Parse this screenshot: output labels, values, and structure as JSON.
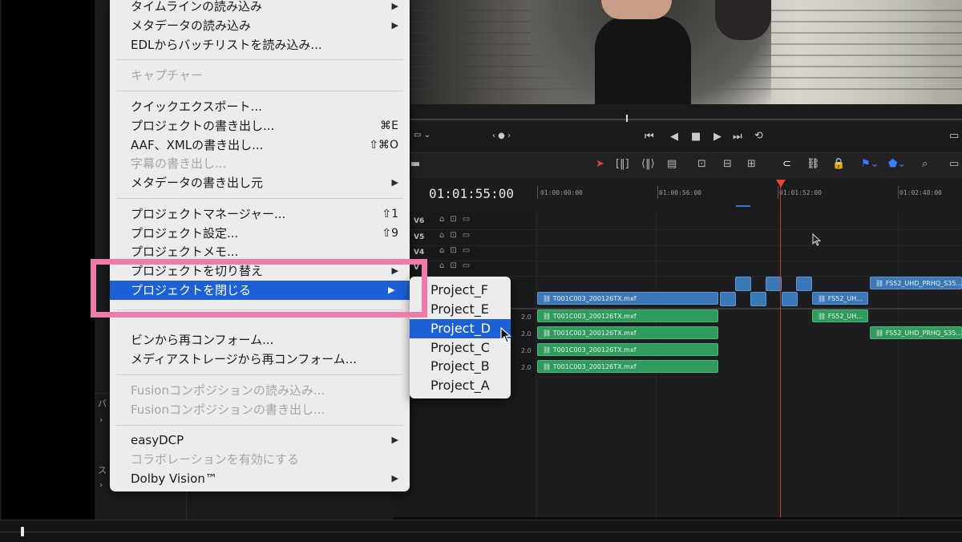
{
  "menu": {
    "items": [
      {
        "label": "タイムラインの読み込み",
        "arrow": "▶",
        "disabled": false
      },
      {
        "label": "メタデータの読み込み",
        "arrow": "▶",
        "disabled": false
      },
      {
        "label": "EDLからバッチリストを読み込み...",
        "disabled": false
      },
      {
        "label": "キャプチャー",
        "disabled": true
      },
      {
        "label": "クイックエクスポート...",
        "disabled": false
      },
      {
        "label": "プロジェクトの書き出し...",
        "shortcut": "⌘E",
        "disabled": false
      },
      {
        "label": "AAF、XMLの書き出し...",
        "shortcut": "⇧⌘O",
        "disabled": false
      },
      {
        "label": "字幕の書き出し...",
        "disabled": true
      },
      {
        "label": "メタデータの書き出し元",
        "arrow": "▶",
        "disabled": false
      },
      {
        "label": "プロジェクトマネージャー...",
        "shortcut": "⇧1",
        "disabled": false
      },
      {
        "label": "プロジェクト設定...",
        "shortcut": "⇧9",
        "disabled": false
      },
      {
        "label": "プロジェクトメモ...",
        "disabled": false
      },
      {
        "label": "プロジェクトを切り替え",
        "arrow": "▶",
        "disabled": false
      },
      {
        "label": "プロジェクトを閉じる",
        "arrow": "▶",
        "highlighted": true
      },
      {
        "label": "ビンから再コンフォーム...",
        "disabled": false
      },
      {
        "label": "メディアストレージから再コンフォーム...",
        "disabled": false
      },
      {
        "label": "Fusionコンポジションの読み込み...",
        "disabled": true
      },
      {
        "label": "Fusionコンポジションの書き出し...",
        "disabled": true
      },
      {
        "label": "easyDCP",
        "arrow": "▶",
        "disabled": false
      },
      {
        "label": "コラボレーションを有効にする",
        "disabled": true
      },
      {
        "label": "Dolby Vision™",
        "arrow": "▶",
        "disabled": false
      }
    ]
  },
  "submenu": {
    "items": [
      "Project_F",
      "Project_E",
      "Project_D",
      "Project_C",
      "Project_B",
      "Project_A"
    ],
    "highlighted_index": 2
  },
  "timeline": {
    "timecode": "01:01:55:00",
    "ruler": [
      "01:00:00:00",
      "01:00:56:00",
      "01:01:52:00",
      "01:02:48:00"
    ],
    "video_tracks": [
      "V6",
      "V5",
      "V4",
      "V"
    ],
    "audio_volume": [
      "2.0",
      "2.0",
      "2.0",
      "2.0",
      "2.0"
    ],
    "clip_name_main": "T001C003_200126TX.mxf",
    "clip_name_fs52_short": "FS52_UH...",
    "clip_name_fs52_long": "FS52_UHD_PRHQ_S35..."
  },
  "left_panel": {
    "label1": "パ",
    "label2": "ス"
  },
  "icons": {
    "chevron": "›",
    "cursor": "arrow-pointer-icon",
    "link": "link-icon"
  },
  "colors": {
    "menu_highlight": "#1d5fd5",
    "annotation": "#f07aa9",
    "clip_blue": "#3a78b7",
    "clip_green": "#2f9b5d",
    "playhead": "#e1473a"
  }
}
